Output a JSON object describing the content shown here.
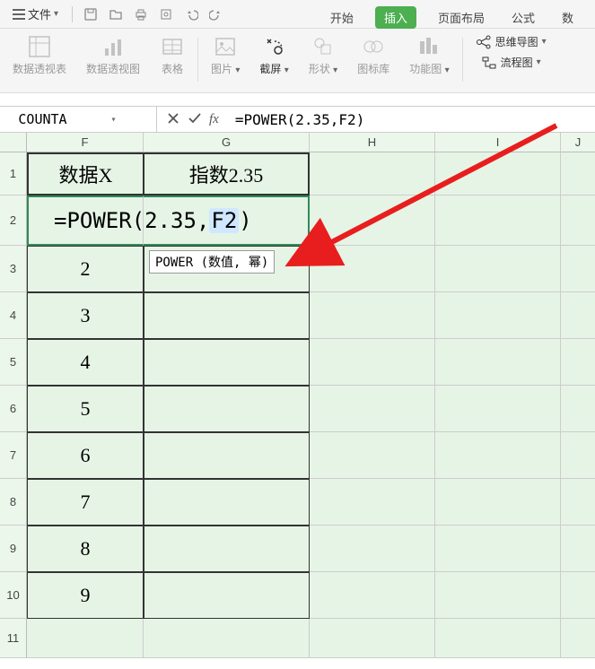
{
  "topbar": {
    "file_menu": "文件"
  },
  "tabs": {
    "t1": "开始",
    "t2": "插入",
    "t3": "页面布局",
    "t4": "公式",
    "t5": "数"
  },
  "ribbon": {
    "g1": "数据透视表",
    "g2": "数据透视图",
    "g3": "表格",
    "g4": "图片",
    "g5": "截屏",
    "g6": "形状",
    "g7": "图标库",
    "g8": "功能图",
    "g9a": "思维导图",
    "g9b": "流程图"
  },
  "formula_bar": {
    "name": "COUNTA",
    "formula": "=POWER(2.35,F2)"
  },
  "cols": {
    "F": "F",
    "G": "G",
    "H": "H",
    "I": "I",
    "J": "J"
  },
  "rows": {
    "r1": "1",
    "r2": "2",
    "r3": "3",
    "r4": "4",
    "r5": "5",
    "r6": "6",
    "r7": "7",
    "r8": "8",
    "r9": "9",
    "r10": "10",
    "r11": "11"
  },
  "headers": {
    "dataX": "数据X",
    "exponent": "指数2.35"
  },
  "editing": {
    "before": "=POWER(2.35,",
    "ref": "F2",
    "after": ")"
  },
  "tooltip": "POWER (数值, 幂)",
  "data": {
    "d3": "2",
    "d4": "3",
    "d5": "4",
    "d6": "5",
    "d7": "6",
    "d8": "7",
    "d9": "8",
    "d10": "9"
  }
}
